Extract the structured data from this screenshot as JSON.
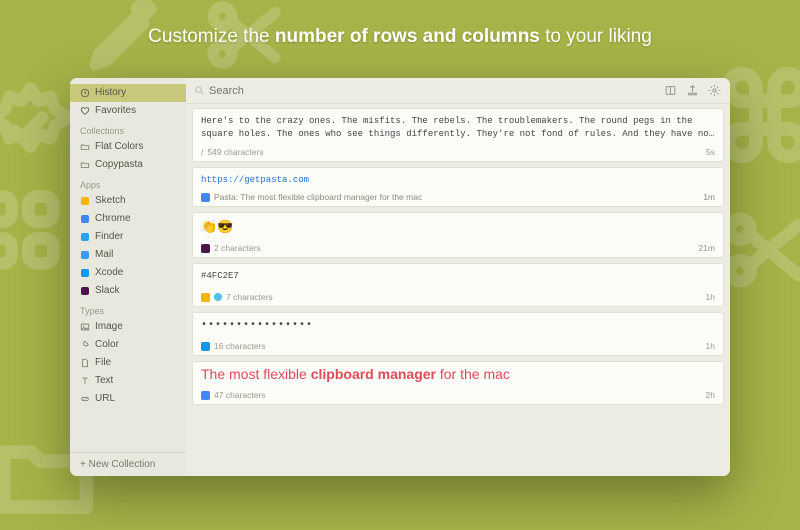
{
  "tagline": {
    "pre": "Customize the ",
    "strong": "number of rows and columns",
    "post": " to your liking"
  },
  "sidebar": {
    "primary": [
      {
        "icon": "clock-icon",
        "label": "History",
        "active": true
      },
      {
        "icon": "heart-icon",
        "label": "Favorites",
        "active": false
      }
    ],
    "groups": [
      {
        "header": "Collections",
        "items": [
          {
            "icon": "folder-icon",
            "label": "Flat Colors"
          },
          {
            "icon": "folder-icon",
            "label": "Copypasta"
          }
        ]
      },
      {
        "header": "Apps",
        "items": [
          {
            "icon": "app-sketch",
            "label": "Sketch",
            "color": "#f7b500"
          },
          {
            "icon": "app-chrome",
            "label": "Chrome",
            "color": "#4285f4"
          },
          {
            "icon": "app-finder",
            "label": "Finder",
            "color": "#2aa3ef"
          },
          {
            "icon": "app-mail",
            "label": "Mail",
            "color": "#3b9cf2"
          },
          {
            "icon": "app-xcode",
            "label": "Xcode",
            "color": "#1497e8"
          },
          {
            "icon": "app-slack",
            "label": "Slack",
            "color": "#4a154b"
          }
        ]
      },
      {
        "header": "Types",
        "items": [
          {
            "icon": "image-icon",
            "label": "Image"
          },
          {
            "icon": "color-icon",
            "label": "Color"
          },
          {
            "icon": "file-icon",
            "label": "File"
          },
          {
            "icon": "text-icon",
            "label": "Text"
          },
          {
            "icon": "url-icon",
            "label": "URL"
          }
        ]
      }
    ],
    "footer": {
      "label": "New Collection"
    }
  },
  "toolbar": {
    "search_placeholder": "Search"
  },
  "clips": [
    {
      "kind": "mono",
      "content": "Here's to the crazy ones. The misfits. The rebels. The troublemakers. The round pegs in the square holes. The ones who see things differently. They're not fond of rules. And they have no respect for…",
      "meta_icons": [
        {
          "type": "glyph",
          "char": "/"
        }
      ],
      "meta_text": "549 characters",
      "time": "5s"
    },
    {
      "kind": "link",
      "content": "https://getpasta.com",
      "subtitle": "Pasta: The most flexible clipboard manager for the mac",
      "meta_icons": [
        {
          "type": "app",
          "color": "#4285f4"
        }
      ],
      "meta_text": "",
      "time": "1m"
    },
    {
      "kind": "emoji",
      "content": "👏😎",
      "meta_icons": [
        {
          "type": "app",
          "color": "#4a154b"
        }
      ],
      "meta_text": "2 characters",
      "time": "21m"
    },
    {
      "kind": "hex",
      "content": "#4FC2E7",
      "meta_icons": [
        {
          "type": "app",
          "color": "#f7b500"
        },
        {
          "type": "swatch",
          "color": "#4FC2E7"
        }
      ],
      "meta_text": "7 characters",
      "time": "1h"
    },
    {
      "kind": "dots",
      "content": "••••••••••••••••",
      "meta_icons": [
        {
          "type": "app",
          "color": "#1497e8"
        }
      ],
      "meta_text": "16 characters",
      "time": "1h"
    },
    {
      "kind": "slogan",
      "content_pre": "The most flexible ",
      "content_strong": "clipboard manager",
      "content_post": " for the mac",
      "meta_icons": [
        {
          "type": "app",
          "color": "#4285f4"
        }
      ],
      "meta_text": "47 characters",
      "time": "2h"
    }
  ]
}
